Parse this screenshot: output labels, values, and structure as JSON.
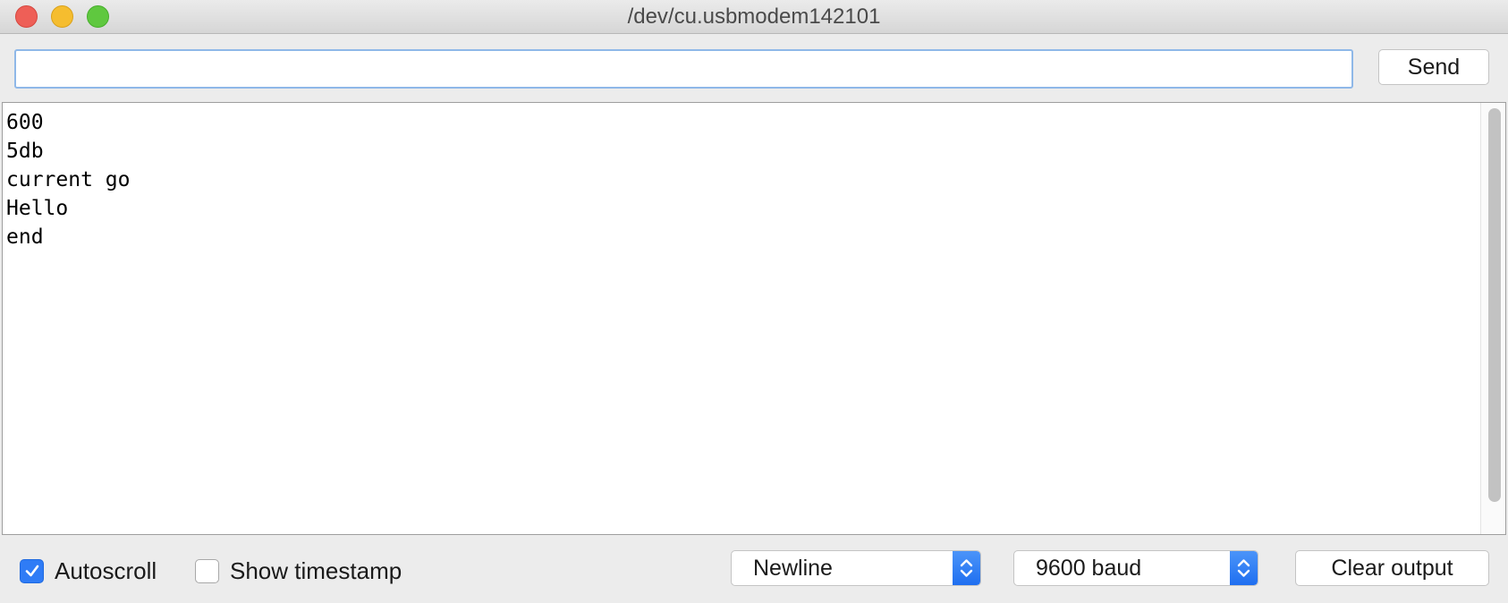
{
  "window": {
    "title": "/dev/cu.usbmodem142101"
  },
  "input_row": {
    "input_value": "",
    "send_label": "Send"
  },
  "output": {
    "lines": [
      "600",
      "5db",
      "current go",
      "Hello",
      "end"
    ]
  },
  "bottom_bar": {
    "autoscroll": {
      "label": "Autoscroll",
      "checked": true
    },
    "show_timestamp": {
      "label": "Show timestamp",
      "checked": false
    },
    "line_ending": {
      "selected": "Newline"
    },
    "baud_rate": {
      "selected": "9600 baud"
    },
    "clear_label": "Clear output"
  },
  "colors": {
    "accent": "#2f7cf6",
    "close": "#ee5f57",
    "minimize": "#f5bd2f",
    "maximize": "#5fc83f"
  },
  "icons": {
    "checkmark": "checkmark-icon",
    "select_chevrons": "chevron-up-down-icon"
  }
}
